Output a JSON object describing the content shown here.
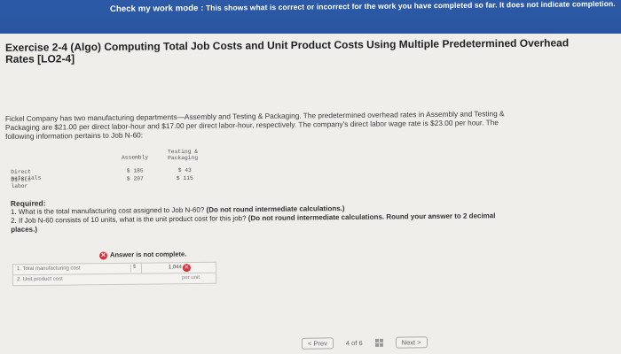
{
  "banner": {
    "label": "Check my work mode :",
    "text": "This shows what is correct or incorrect for the work you have completed so far. It does not indicate completion."
  },
  "exercise": {
    "title": "Exercise 2-4 (Algo) Computing Total Job Costs and Unit Product Costs Using Multiple Predetermined Overhead Rates [LO2-4]",
    "intro": "Fickel Company has two manufacturing departments—Assembly and Testing & Packaging. The predetermined overhead rates in Assembly and Testing & Packaging are $21.00 per direct labor-hour and $17.00 per direct labor-hour, respectively. The company's direct labor wage rate is $23.00 per hour. The following information pertains to Job N-60:"
  },
  "job_table": {
    "col1": "Assembly",
    "col2_line1": "Testing &",
    "col2_line2": "Packaging",
    "rows": [
      {
        "label": "Direct materials",
        "assembly": "$ 185",
        "testing": "$ 43"
      },
      {
        "label": "Direct labor",
        "assembly": "$ 207",
        "testing": "$ 115"
      }
    ]
  },
  "required": {
    "heading": "Required:",
    "q1": "1. What is the total manufacturing cost assigned to Job N-60?",
    "q1_note": "(Do not round intermediate calculations.)",
    "q2": "2. If Job N-60 consists of 10 units, what is the unit product cost for this job?",
    "q2_note": "(Do not round intermediate calculations. Round your answer to 2 decimal places.)"
  },
  "answer": {
    "status": "Answer is not complete.",
    "rows": [
      {
        "label": "1. Total manufacturing cost",
        "dollar": "$",
        "value": "1,044"
      },
      {
        "label": "2. Unit product cost",
        "unit": "per unit"
      }
    ]
  },
  "pager": {
    "prev": "< Prev",
    "position": "4 of 6",
    "next": "Next >"
  }
}
